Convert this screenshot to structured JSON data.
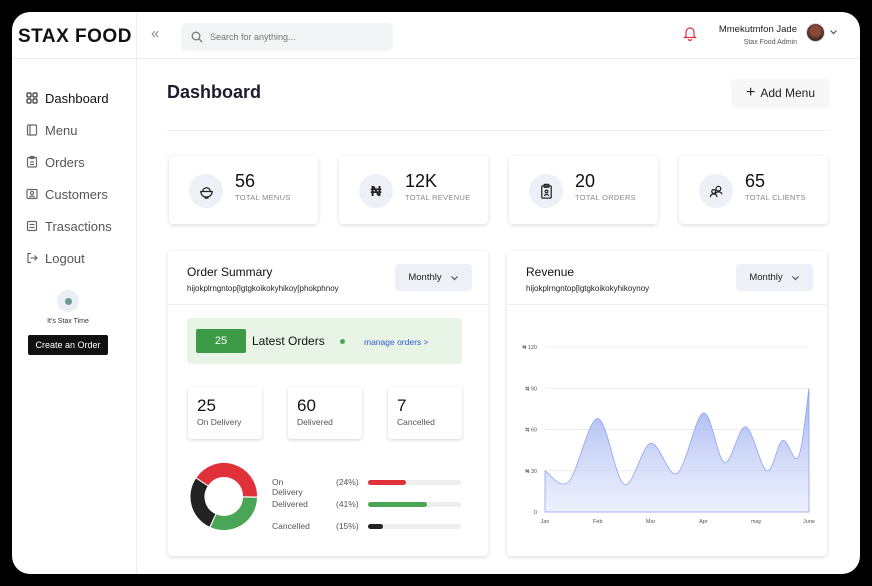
{
  "brand": "STAX FOOD",
  "sidebar": {
    "items": [
      {
        "label": "Dashboard",
        "icon": "grid-icon"
      },
      {
        "label": "Menu",
        "icon": "book-icon"
      },
      {
        "label": "Orders",
        "icon": "clipboard-icon"
      },
      {
        "label": "Customers",
        "icon": "id-card-icon"
      },
      {
        "label": "Trasactions",
        "icon": "receipt-icon"
      },
      {
        "label": "Logout",
        "icon": "logout-icon"
      }
    ],
    "promo_text": "It's Stax Time",
    "promo_button": "Create an Order"
  },
  "header": {
    "search_placeholder": "Search for anything...",
    "user_name": "Mmekutmfon Jade",
    "user_role": "Stax Food Admin"
  },
  "page": {
    "title": "Dashboard",
    "add_button": "Add Menu"
  },
  "stats": [
    {
      "value": "56",
      "label": "TOTAL MENUS",
      "icon": "food-bowl-icon"
    },
    {
      "value": "12K",
      "label": "TOTAL REVENUE",
      "icon": "naira-icon",
      "symbol": "₦"
    },
    {
      "value": "20",
      "label": "TOTAL ORDERS",
      "icon": "clipboard-icon"
    },
    {
      "value": "65",
      "label": "TOTAL CLIENTS",
      "icon": "users-icon"
    }
  ],
  "order_summary": {
    "title": "Order Summary",
    "subtitle": "hijokplrngntop[lgtgkoikokyhikoy[phokphnoy",
    "dropdown": "Monthly",
    "latest_count": "25",
    "latest_title": "Latest Orders",
    "manage_link": "manage orders  >",
    "mini_stats": [
      {
        "value": "25",
        "label": "On Delivery"
      },
      {
        "value": "60",
        "label": "Delivered"
      },
      {
        "value": "7",
        "label": "Cancelled"
      }
    ],
    "breakdown": [
      {
        "label": "On Delivery",
        "percent": "(24%)",
        "fraction": 0.41,
        "color": "#e0313b"
      },
      {
        "label": "Delivered",
        "percent": "(41%)",
        "fraction": 0.63,
        "color": "#4aa656"
      },
      {
        "label": "Cancelled",
        "percent": "(15%)",
        "fraction": 0.16,
        "color": "#222222"
      }
    ]
  },
  "revenue": {
    "title": "Revenue",
    "subtitle": "hijokplrngntop[lgtgkoikokyhikoynoy",
    "dropdown": "Monthly"
  },
  "chart_data": {
    "type": "area",
    "title": "Revenue",
    "x": [
      "Jan",
      "Feb",
      "Mar",
      "Apr",
      "may",
      "June"
    ],
    "series": [
      {
        "values": [
          30,
          22,
          68,
          20,
          50,
          28,
          72,
          36,
          62,
          30,
          52,
          40,
          90
        ]
      }
    ],
    "x_positions": [
      0,
      0.45,
      1,
      1.5,
      2,
      2.5,
      3,
      3.4,
      3.8,
      4.2,
      4.5,
      4.8,
      5
    ],
    "ylim": [
      0,
      120
    ],
    "yticks": [
      "0",
      "₦ 30",
      "₦ 60",
      "₦ 90",
      "₦ 120"
    ],
    "ytick_values": [
      0,
      30,
      60,
      90,
      120
    ],
    "grid": true,
    "color": "#8fa3f0"
  }
}
